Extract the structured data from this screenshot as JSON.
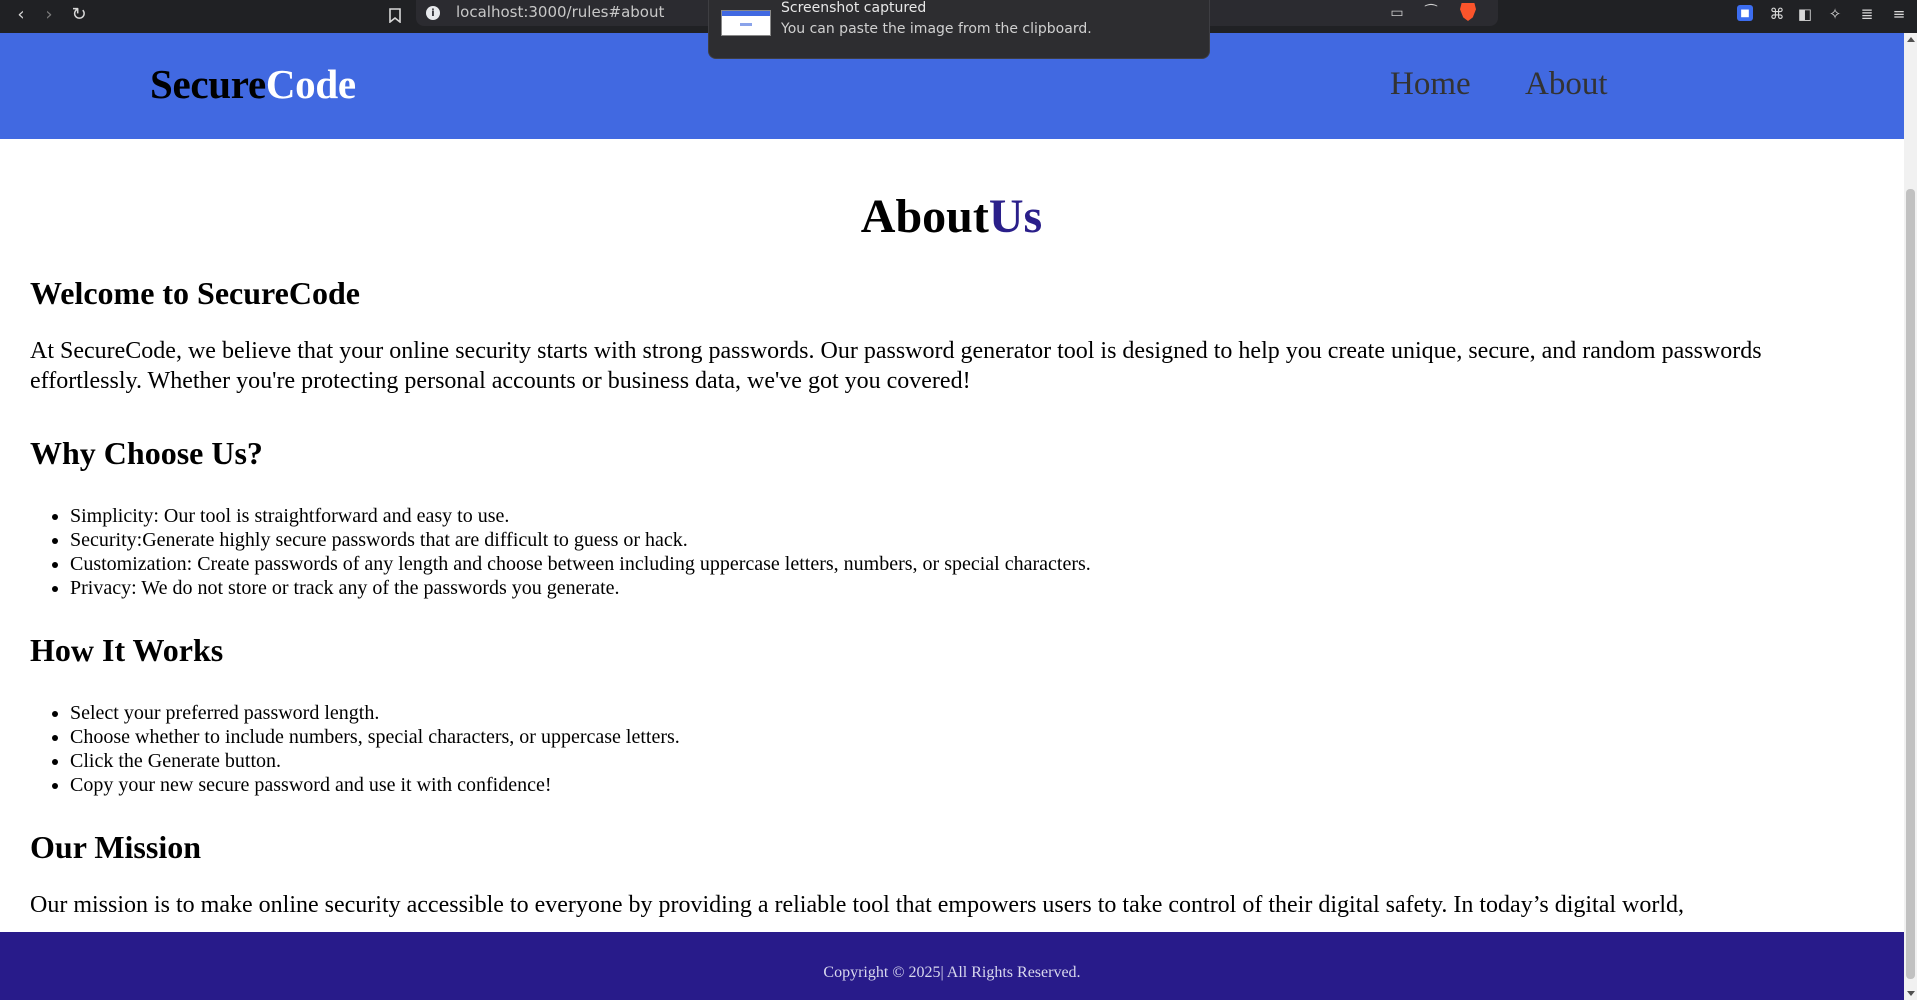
{
  "browser": {
    "url": "localhost:3000/rules#about",
    "toast": {
      "title": "Screenshot captured",
      "message": "You can paste the image from the clipboard."
    }
  },
  "header": {
    "logo_part1": "Secure",
    "logo_part2": "Code",
    "nav": [
      "Home",
      "About"
    ]
  },
  "about": {
    "title_part1": "About",
    "title_part2": "Us",
    "welcome_heading": "Welcome to SecureCode",
    "welcome_text": "At SecureCode, we believe that your online security starts with strong passwords. Our password generator tool is designed to help you create unique, secure, and random passwords effortlessly. Whether you're protecting personal accounts or business data, we've got you covered!",
    "why_heading": "Why Choose Us?",
    "why_items": [
      "Simplicity: Our tool is straightforward and easy to use.",
      "Security:Generate highly secure passwords that are difficult to guess or hack.",
      "Customization: Create passwords of any length and choose between including uppercase letters, numbers, or special characters.",
      "Privacy: We do not store or track any of the passwords you generate."
    ],
    "how_heading": "How It Works",
    "how_items": [
      "Select your preferred password length.",
      "Choose whether to include numbers, special characters, or uppercase letters.",
      "Click the Generate button.",
      "Copy your new secure password and use it with confidence!"
    ],
    "mission_heading": "Our Mission",
    "mission_text": "Our mission is to make online security accessible to everyone by providing a reliable tool that empowers users to take control of their digital safety. In today’s digital world,"
  },
  "footer": {
    "copyright": "Copyright © 2025| All Rights Reserved."
  },
  "colors": {
    "header_bg": "#4169e1",
    "footer_bg": "#281b8a",
    "accent": "#2a1f8a"
  }
}
